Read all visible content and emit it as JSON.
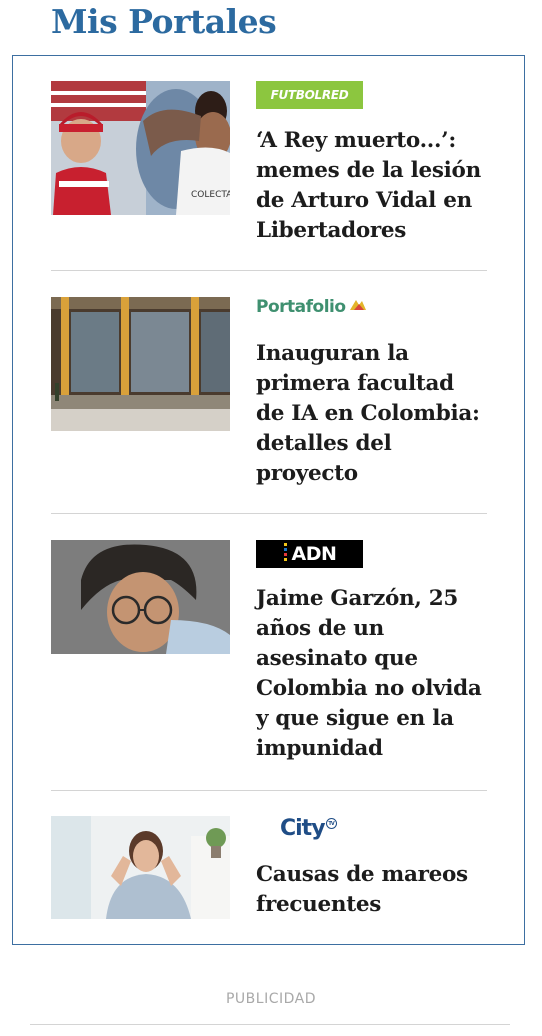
{
  "section": {
    "title": "Mis Portales"
  },
  "articles": [
    {
      "source": "FUTBOLRED",
      "headline": "‘A Rey muerto...’: memes de la lesión de Arturo Vidal en Libertadores",
      "jersey_text": "COLECTA"
    },
    {
      "source": "Portafolio",
      "headline": "Inauguran la primera facultad de IA en Colombia: detalles del proyecto"
    },
    {
      "source": "ADN",
      "headline": "Jaime Garzón, 25 años de un asesinato que Colombia no olvida y que sigue en la impunidad"
    },
    {
      "source": "City",
      "badge": "TV",
      "headline": "Causas de mareos frecuentes"
    }
  ],
  "ad": {
    "label": "PUBLICIDAD"
  },
  "colors": {
    "title": "#2c6aa0",
    "border": "#3d6fa1",
    "futbolred": "#8cc63f",
    "portafolio": "#3f9070",
    "city": "#1f4d86"
  }
}
